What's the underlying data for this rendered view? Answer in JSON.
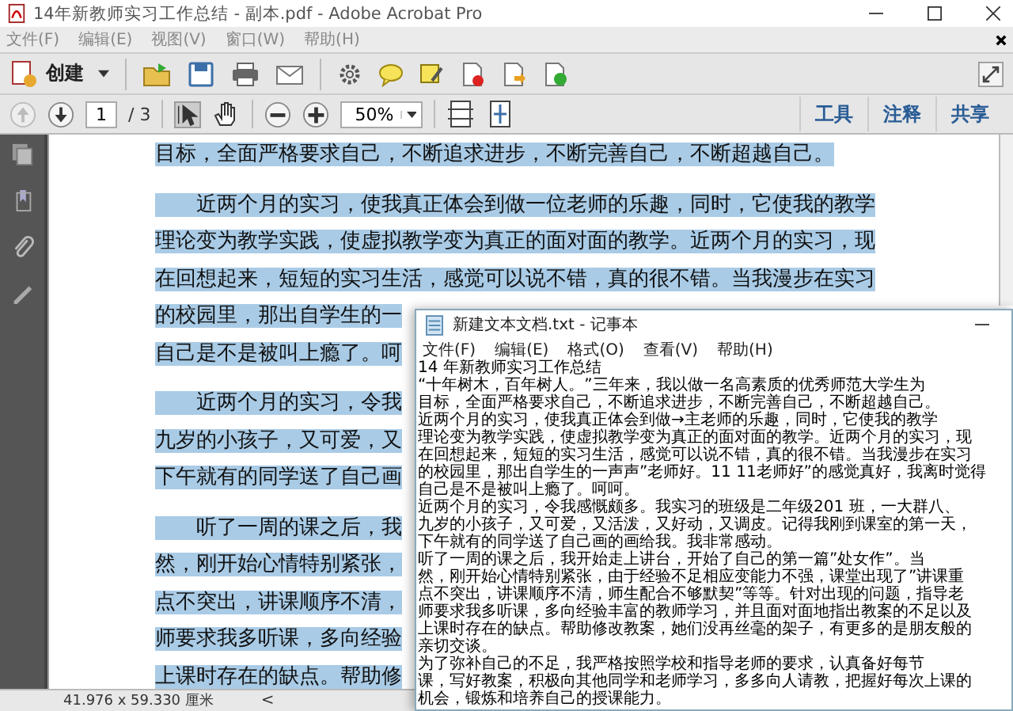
{
  "window": {
    "title": "14年新教师实习工作总结 - 副本.pdf - Adobe Acrobat Pro"
  },
  "menu": [
    "文件(F)",
    "编辑(E)",
    "视图(V)",
    "窗口(W)",
    "帮助(H)"
  ],
  "toolbar": {
    "create_label": "创建"
  },
  "page_nav": {
    "page": "1",
    "total": "/ 3",
    "zoom": "50%"
  },
  "panes": [
    "工具",
    "注释",
    "共享"
  ],
  "document": {
    "selected": true,
    "paragraphs": [
      {
        "lines": [
          "目标，全面严格要求自己，不断追求进步，不断完善自己，不断超越自己。"
        ]
      },
      {
        "lines": [
          "　　近两个月的实习，使我真正体会到做一位老师的乐趣，同时，它使我的教学",
          "理论变为教学实践，使虚拟教学变为真正的面对面的教学。近两个月的实习，现",
          "在回想起来，短短的实习生活，感觉可以说不错，真的很不错。当我漫步在实习",
          "的校园里，那出自学生的一",
          "自己是不是被叫上瘾了。呵"
        ]
      },
      {
        "lines": [
          "　　近两个月的实习，令我",
          "九岁的小孩子，又可爱，又",
          "下午就有的同学送了自己画"
        ]
      },
      {
        "lines": [
          "　　听了一周的课之后，我",
          "然，刚开始心情特别紧张，",
          "点不突出，讲课顺序不清，",
          "师要求我多听课，多向经验",
          "上课时存在的缺点。帮助修"
        ]
      }
    ]
  },
  "status_bar": {
    "page_size": "41.976 x 59.330 厘米",
    "scroll_left": "<"
  },
  "notepad": {
    "title": "新建文本文档.txt - 记事本",
    "menu": [
      "文件(F)",
      "编辑(E)",
      "格式(O)",
      "查看(V)",
      "帮助(H)"
    ],
    "lines": [
      "14 年新教师实习工作总结",
      "“十年树木，百年树人。”三年来，我以做一名高素质的优秀师范大学生为",
      "目标，全面严格要求自己，不断追求进步，不断完善自己，不断超越自己。",
      "近两个月的实习，使我真正体会到做→主老师的乐趣，同时，它使我的教学",
      "理论变为教学实践，使虚拟教学变为真正的面对面的教学。近两个月的实习，现",
      "在回想起来，短短的实习生活，感觉可以说不错，真的很不错。当我漫步在实习",
      "的校园里，那出自学生的一声声”老师好。11 11老师好”的感觉真好，我离时觉得",
      "自己是不是被叫上瘾了。呵呵。",
      "近两个月的实习，令我感慨颇多。我实习的班级是二年级201 班，一大群八、",
      "九岁的小孩子，又可爱，又活泼，又好动，又调皮。记得我刚到课室的第一天，",
      "下午就有的同学送了自己画的画给我。我非常感动。",
      "听了一周的课之后，我开始走上讲台，开始了自己的第一篇”处女作”。当",
      "然，刚开始心情特别紧张，由于经验不足相应变能力不强，课堂出现了”讲课重",
      "点不突出，讲课顺序不清，师生配合不够默契”等等。针对出现的问题，指导老",
      "师要求我多听课，多向经验丰富的教师学习，并且面对面地指出教案的不足以及",
      "上课时存在的缺点。帮助修改教案，她们没再丝毫的架子，有更多的是朋友般的",
      "亲切交谈。",
      "为了弥补自己的不足，我严格按照学校和指导老师的要求，认真备好每节",
      "课，写好教案，积极向其他同学和老师学习，多多向人请教，把握好每次上课的",
      "机会，锻炼和培养自己的授课能力。"
    ]
  }
}
